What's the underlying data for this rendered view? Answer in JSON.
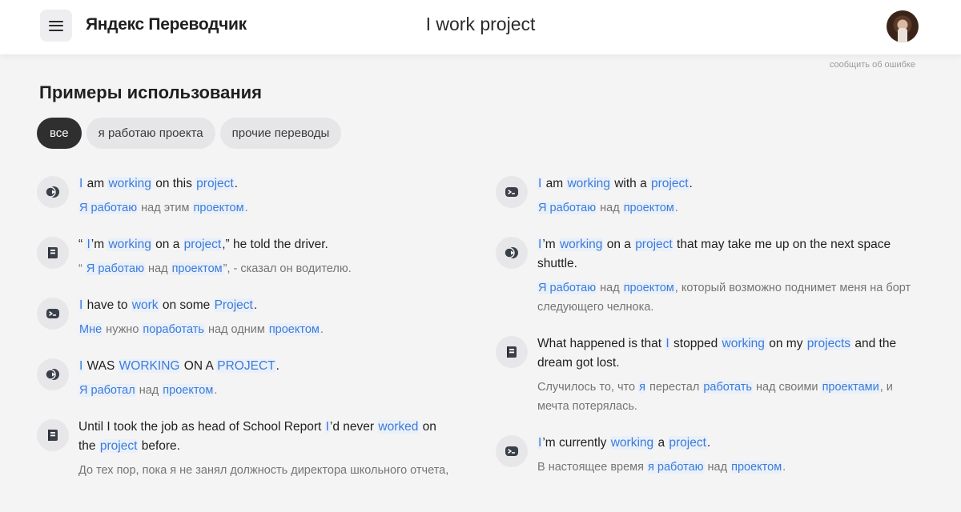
{
  "header": {
    "logo": "Яндекс Переводчик",
    "query": "I work project",
    "menu_icon": "hamburger-icon",
    "report_link": "сообщить об ошибке"
  },
  "section": {
    "title": "Примеры использования"
  },
  "filters": [
    {
      "label": "все",
      "active": true
    },
    {
      "label": "я работаю проекта",
      "active": false
    },
    {
      "label": "прочие переводы",
      "active": false
    }
  ],
  "colors": {
    "highlight_text": "#3c7bd6",
    "highlight_bg": "#eaf0fa",
    "active_chip": "#2f2f2f"
  },
  "examples_left": [
    {
      "icon": "video-icon",
      "source": [
        {
          "t": "I",
          "h": true
        },
        {
          "t": " am "
        },
        {
          "t": "working",
          "h": true
        },
        {
          "t": " on this "
        },
        {
          "t": "project",
          "h": true
        },
        {
          "t": "."
        }
      ],
      "translation": [
        {
          "t": "Я работаю",
          "h": true
        },
        {
          "t": " над этим "
        },
        {
          "t": "проектом",
          "h": true
        },
        {
          "t": "."
        }
      ]
    },
    {
      "icon": "book-icon",
      "source": [
        {
          "t": "“ "
        },
        {
          "t": "I",
          "h": true
        },
        {
          "t": "’m "
        },
        {
          "t": "working",
          "h": true
        },
        {
          "t": " on a "
        },
        {
          "t": "project",
          "h": true
        },
        {
          "t": ",” he told the driver."
        }
      ],
      "translation": [
        {
          "t": "“ "
        },
        {
          "t": "Я работаю",
          "h": true
        },
        {
          "t": " над "
        },
        {
          "t": "проектом",
          "h": true
        },
        {
          "t": "”, - сказал он водителю."
        }
      ]
    },
    {
      "icon": "terminal-icon",
      "source": [
        {
          "t": "I",
          "h": true
        },
        {
          "t": " have to "
        },
        {
          "t": "work",
          "h": true
        },
        {
          "t": " on some "
        },
        {
          "t": "Project",
          "h": true
        },
        {
          "t": "."
        }
      ],
      "translation": [
        {
          "t": "Мне",
          "h": true
        },
        {
          "t": " нужно "
        },
        {
          "t": "поработать",
          "h": true
        },
        {
          "t": " над одним "
        },
        {
          "t": "проектом",
          "h": true
        },
        {
          "t": "."
        }
      ]
    },
    {
      "icon": "video-icon",
      "source": [
        {
          "t": "I",
          "h": true
        },
        {
          "t": " WAS "
        },
        {
          "t": "WORKING",
          "h": true
        },
        {
          "t": " ON A "
        },
        {
          "t": "PROJECT",
          "h": true
        },
        {
          "t": "."
        }
      ],
      "translation": [
        {
          "t": "Я работал",
          "h": true
        },
        {
          "t": " над "
        },
        {
          "t": "проектом",
          "h": true
        },
        {
          "t": "."
        }
      ]
    },
    {
      "icon": "book-icon",
      "source": [
        {
          "t": "Until I took the job as head of School Report "
        },
        {
          "t": "I",
          "h": true
        },
        {
          "t": "’d never "
        },
        {
          "t": "worked",
          "h": true
        },
        {
          "t": " on the "
        },
        {
          "t": "project",
          "h": true
        },
        {
          "t": " before."
        }
      ],
      "translation": [
        {
          "t": "До тех пор, пока я не занял должность директора школьного отчета,"
        }
      ]
    }
  ],
  "examples_right": [
    {
      "icon": "terminal-icon",
      "source": [
        {
          "t": "I",
          "h": true
        },
        {
          "t": " am "
        },
        {
          "t": "working",
          "h": true
        },
        {
          "t": " with a "
        },
        {
          "t": "project",
          "h": true
        },
        {
          "t": "."
        }
      ],
      "translation": [
        {
          "t": "Я работаю",
          "h": true
        },
        {
          "t": " над "
        },
        {
          "t": "проектом",
          "h": true
        },
        {
          "t": "."
        }
      ]
    },
    {
      "icon": "video-icon",
      "source": [
        {
          "t": "I",
          "h": true
        },
        {
          "t": "’m "
        },
        {
          "t": "working",
          "h": true
        },
        {
          "t": " on a "
        },
        {
          "t": "project",
          "h": true
        },
        {
          "t": " that may take me up on the next space shuttle."
        }
      ],
      "translation": [
        {
          "t": "Я работаю",
          "h": true
        },
        {
          "t": " над "
        },
        {
          "t": "проектом",
          "h": true
        },
        {
          "t": ", который возможно поднимет меня на борт следующего челнока."
        }
      ]
    },
    {
      "icon": "book-icon",
      "source": [
        {
          "t": "What happened is that "
        },
        {
          "t": "I",
          "h": true
        },
        {
          "t": " stopped "
        },
        {
          "t": "working",
          "h": true
        },
        {
          "t": " on my "
        },
        {
          "t": "projects",
          "h": true
        },
        {
          "t": " and the dream got lost."
        }
      ],
      "translation": [
        {
          "t": "Случилось то, что "
        },
        {
          "t": "я",
          "h": true
        },
        {
          "t": " перестал "
        },
        {
          "t": "работать",
          "h": true
        },
        {
          "t": " над своими "
        },
        {
          "t": "проектами",
          "h": true
        },
        {
          "t": ", и мечта потерялась."
        }
      ]
    },
    {
      "icon": "terminal-icon",
      "source": [
        {
          "t": "I",
          "h": true
        },
        {
          "t": "’m currently "
        },
        {
          "t": "working",
          "h": true
        },
        {
          "t": " a "
        },
        {
          "t": "project",
          "h": true
        },
        {
          "t": "."
        }
      ],
      "translation": [
        {
          "t": "В настоящее время "
        },
        {
          "t": "я работаю",
          "h": true
        },
        {
          "t": " над "
        },
        {
          "t": "проектом",
          "h": true
        },
        {
          "t": "."
        }
      ]
    }
  ]
}
